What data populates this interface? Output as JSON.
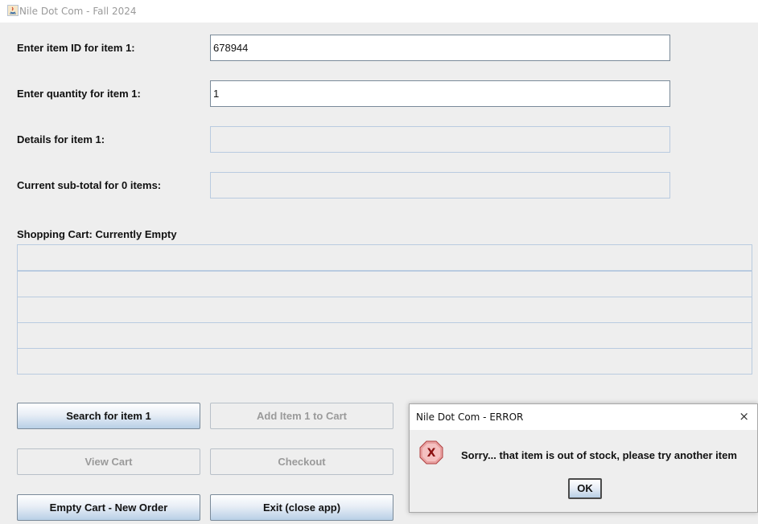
{
  "window": {
    "title": "Nile Dot Com - Fall 2024",
    "icon": "java-app-icon"
  },
  "form": {
    "item_id_label": "Enter item ID for item 1:",
    "item_id_value": "678944",
    "quantity_label": "Enter quantity for item 1:",
    "quantity_value": "1",
    "details_label": "Details for item 1:",
    "details_value": "",
    "subtotal_label": "Current sub-total for 0 items:",
    "subtotal_value": ""
  },
  "cart": {
    "label": "Shopping Cart: Currently Empty",
    "rows": [
      "",
      "",
      "",
      "",
      ""
    ]
  },
  "buttons": {
    "search": "Search for item 1",
    "add": "Add Item 1 to Cart",
    "view": "View Cart",
    "checkout": "Checkout",
    "empty": "Empty Cart - New Order",
    "exit": "Exit (close app)"
  },
  "dialog": {
    "title": "Nile Dot Com - ERROR",
    "close_glyph": "×",
    "message": "Sorry... that item is out of stock, please try another item",
    "ok_label": "OK",
    "icon": "error-icon"
  },
  "colors": {
    "window_bg": "#eeeeee",
    "disabled_border": "#b9cbe0",
    "error_red": "#e02020"
  }
}
